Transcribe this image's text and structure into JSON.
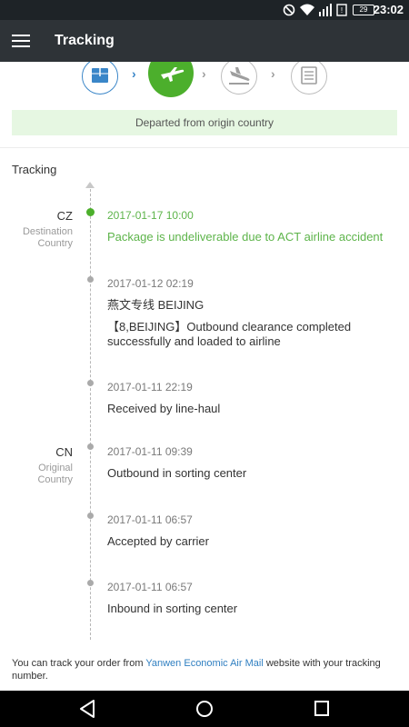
{
  "status_bar": {
    "time": "23:02",
    "battery_level": "29",
    "icons": [
      "do-not-disturb-icon",
      "wifi-icon",
      "cell-signal-icon",
      "sim-icon",
      "battery-icon"
    ]
  },
  "app_bar": {
    "title": "Tracking",
    "menu_icon": "hamburger-menu-icon"
  },
  "steps": {
    "items": [
      {
        "icon": "package-icon",
        "state": "done"
      },
      {
        "icon": "plane-takeoff-icon",
        "state": "current"
      },
      {
        "icon": "plane-landing-icon",
        "state": "pending"
      },
      {
        "icon": "delivered-box-icon",
        "state": "pending"
      }
    ],
    "status_text": "Departed from origin country",
    "colors": {
      "active": "#4caf2c",
      "done": "#3a86c8",
      "pending": "#bdbdbd",
      "banner_bg": "#e6f7e2"
    }
  },
  "tracking": {
    "title": "Tracking",
    "destination": {
      "code": "CZ",
      "label_line1": "Destination",
      "label_line2": "Country"
    },
    "origin": {
      "code": "CN",
      "label_line1": "Original",
      "label_line2": "Country"
    },
    "events": [
      {
        "date": "2017-01-17 10:00",
        "text": "Package is undeliverable due to ACT airline accident",
        "highlight": true
      },
      {
        "date": "2017-01-12 02:19",
        "location": "燕文专线 BEIJING",
        "text": "【8,BEIJING】Outbound clearance completed successfully and loaded to airline"
      },
      {
        "date": "2017-01-11 22:19",
        "text": "Received by line-haul"
      },
      {
        "date": "2017-01-11 09:39",
        "text": "Outbound in sorting center"
      },
      {
        "date": "2017-01-11 06:57",
        "text": "Accepted by carrier"
      },
      {
        "date": "2017-01-11 06:57",
        "text": "Inbound in sorting center"
      }
    ]
  },
  "footer": {
    "prefix": "You can track your order from ",
    "link": "Yanwen Economic Air Mail",
    "suffix": " website with your tracking number."
  },
  "nav_bar": {
    "icons": [
      "back-triangle-icon",
      "home-circle-icon",
      "recents-square-icon"
    ]
  }
}
